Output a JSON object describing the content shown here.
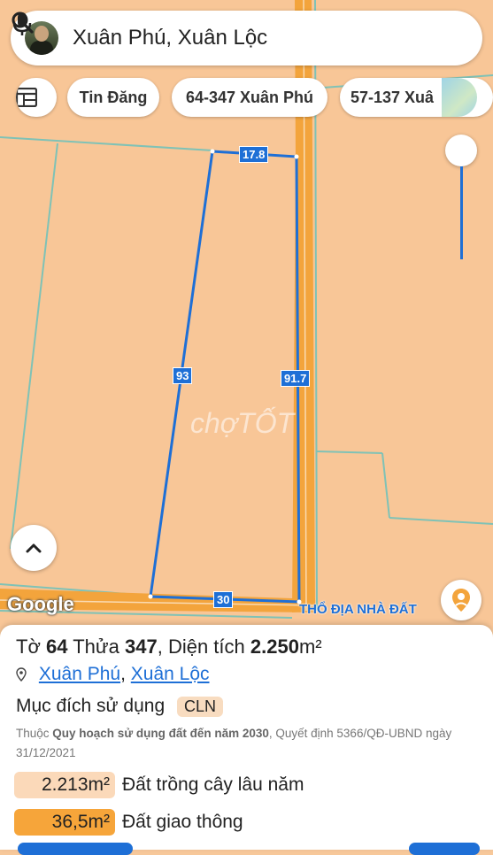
{
  "search": {
    "query": "Xuân Phú, Xuân Lộc"
  },
  "chips": [
    "Tin Đăng",
    "64-347 Xuân Phú",
    "57-137 Xuâ"
  ],
  "map": {
    "edge_labels": {
      "top": "17.8",
      "left": "93",
      "right": "91.7",
      "bottom": "30"
    },
    "google_label": "Google",
    "watermark": "chợTỐT",
    "brand": "THỔ ĐỊA NHÀ ĐẤT"
  },
  "parcel": {
    "to_label": "Tờ",
    "to_value": "64",
    "thua_label": "Thửa",
    "thua_value": "347",
    "dt_label": "Diện tích",
    "dt_value": "2.250",
    "dt_unit": "m²",
    "commune": "Xuân Phú",
    "district": "Xuân Lộc",
    "purpose_label": "Mục đích sử dụng",
    "purpose_code": "CLN",
    "note_prefix": "Thuộc",
    "note_plan": "Quy hoạch sử dụng đất đến năm 2030",
    "note_suffix": ", Quyết định 5366/QĐ-UBND ngày 31/12/2021",
    "areas": [
      {
        "value": "2.213m²",
        "label": "Đất trồng cây lâu năm",
        "color": "#fbd9b9"
      },
      {
        "value": "36,5m²",
        "label": "Đất giao thông",
        "color": "#f6a53a"
      }
    ]
  },
  "colors": {
    "accent": "#1e6fd6",
    "map_bg": "#f8c697",
    "road": "#f3a43c"
  }
}
